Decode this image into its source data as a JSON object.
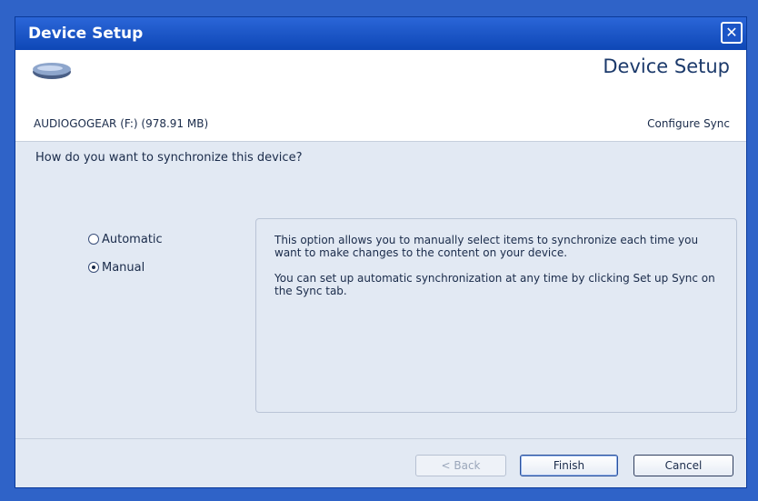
{
  "window": {
    "title": "Device Setup",
    "close_glyph": "✕"
  },
  "header": {
    "title": "Device Setup",
    "device_name": "AUDIOGOGEAR (F:) (978.91 MB)",
    "subtitle": "Configure Sync",
    "icon": "portable-device-icon"
  },
  "content": {
    "question": "How do you want to synchronize this device?",
    "options": [
      {
        "label": "Automatic",
        "selected": false
      },
      {
        "label": "Manual",
        "selected": true
      }
    ],
    "description": [
      "This option allows you to manually select items to synchronize each time you want to make changes to the content on your device.",
      "You can set up automatic synchronization at any time by clicking Set up Sync on the Sync tab."
    ]
  },
  "footer": {
    "back_label": "< Back",
    "back_enabled": false,
    "finish_label": "Finish",
    "cancel_label": "Cancel"
  },
  "colors": {
    "desktop": "#2f63c8",
    "titlebar": "#0e47b6",
    "panel": "#e2e9f3",
    "heading_text": "#1c3a6b"
  }
}
